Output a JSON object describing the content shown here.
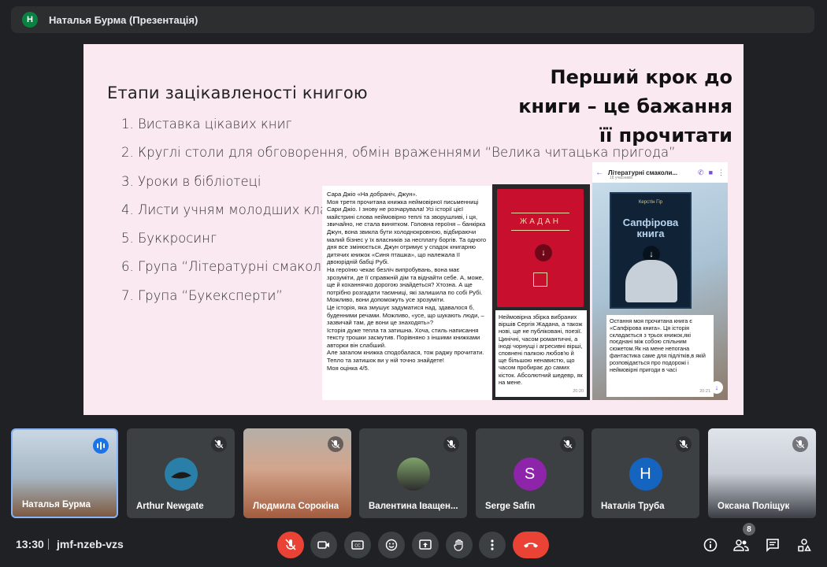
{
  "presenter_bar": {
    "avatar_letter": "Н",
    "title": "Наталья Бурма (Презентація)"
  },
  "slide": {
    "heading": "Етапи зацікавленості книгою",
    "list": [
      "1. Виставка цікавих книг",
      "2. Круглі столи для обговорення, обмін враженнями “Велика читацька пригода”",
      "3. Уроки в бібліотеці",
      "4. Листи учням молодших класів",
      "5. Буккросинг",
      "6. Група “Літературні смаколики”",
      "7. Група “Букексперти”"
    ],
    "big_line1": "Перший крок до",
    "big_line2": "книги – це бажання",
    "big_line3": "її прочитати",
    "post1_text": "Сара Джіо «На добраніч, Джун».\nМоя третя прочитана книжка неймовірної письменниці Сари Джіо. І знову не розчарувала! Усі історії цієї майстрині слова неймовірно теплі та зворушливі, і ця, звичайно, не стала винятком. Головна героїня – банкірка Джун, вона звикла бути холоднокровною, відбираючи малий бізнес у їх власників за несплату боргів. Та одного дня все змінюється. Джун отримує у спадок книгарню дитячих книжок «Синя пташка», що належала її двоюрідній бабці Рубі.\nНа героїню чекає безліч випробувань, вона має зрозуміти, де її справжній дім та віднайти себе. А, може, ще й коханнячко дорогою знайдеться? Хтозна. А ще потрібно розгадати таємниці, які залишила по собі Рубі. Можливо, вони допоможуть усе зрозуміти.\nЦе історія, яка змушує задуматися над, здавалося б, буденними речами. Можливо, «усе, що шукають люди, – зазвичай там, де вони це знаходять»?\nІсторія дуже тепла та затишна. Хоча, стиль написання тексту трошки засмутив. Порівняно з іншими книжками авторки він слабший.\nАле загалом книжка сподобалася, тож раджу прочитати. Тепло та затишок ви у ній точно знайдете!\nМоя оцінка 4/5.",
    "book2_title": "ЖАДАН",
    "post2_text": "Неймовірна збірка вибраних віршів Сергія Жадана, а також нові, ще не публіковані, поезії. Цинічні, часом романтичні, а іноді чорнущі і агресивні вірші, сповнені палкою любов'ю й ще більшою ненавистю, що часом пробирає до самих кісток. Абсолютний шедевр, як на мене.",
    "post2_time": "20:20",
    "chat_name": "Літературні смаколи...",
    "chat_sub": "18 учасників",
    "book3_author": "Керстін Гір",
    "book3_title": "Сапфірова книга",
    "post3_text": "Остання моя прочитана книга є «Сапфірова книга». Ця історія складається з трьох книжок,які поєднані між собою спільним сюжетом.Як на мене непогана фантастика саме для підлітків,в якій розповідається про подорожі і неймовірні пригоди в часі",
    "post3_time": "20:21"
  },
  "participants": [
    {
      "name": "Наталья Бурма"
    },
    {
      "name": "Arthur Newgate"
    },
    {
      "name": "Людмила Сорокіна"
    },
    {
      "name": "Валентина Іващен..."
    },
    {
      "name": "Serge Safin",
      "letter": "S",
      "color": "#8e24aa"
    },
    {
      "name": "Наталія Труба",
      "letter": "Н",
      "color": "#1565c0"
    },
    {
      "name": "Оксана Поліщук"
    }
  ],
  "bottom": {
    "time": "13:30",
    "meeting_code": "jmf-nzeb-vzs",
    "people_count": "8"
  },
  "colors": {
    "end_call": "#ea4335",
    "active_border": "#8ab4f8",
    "background": "#202124"
  }
}
